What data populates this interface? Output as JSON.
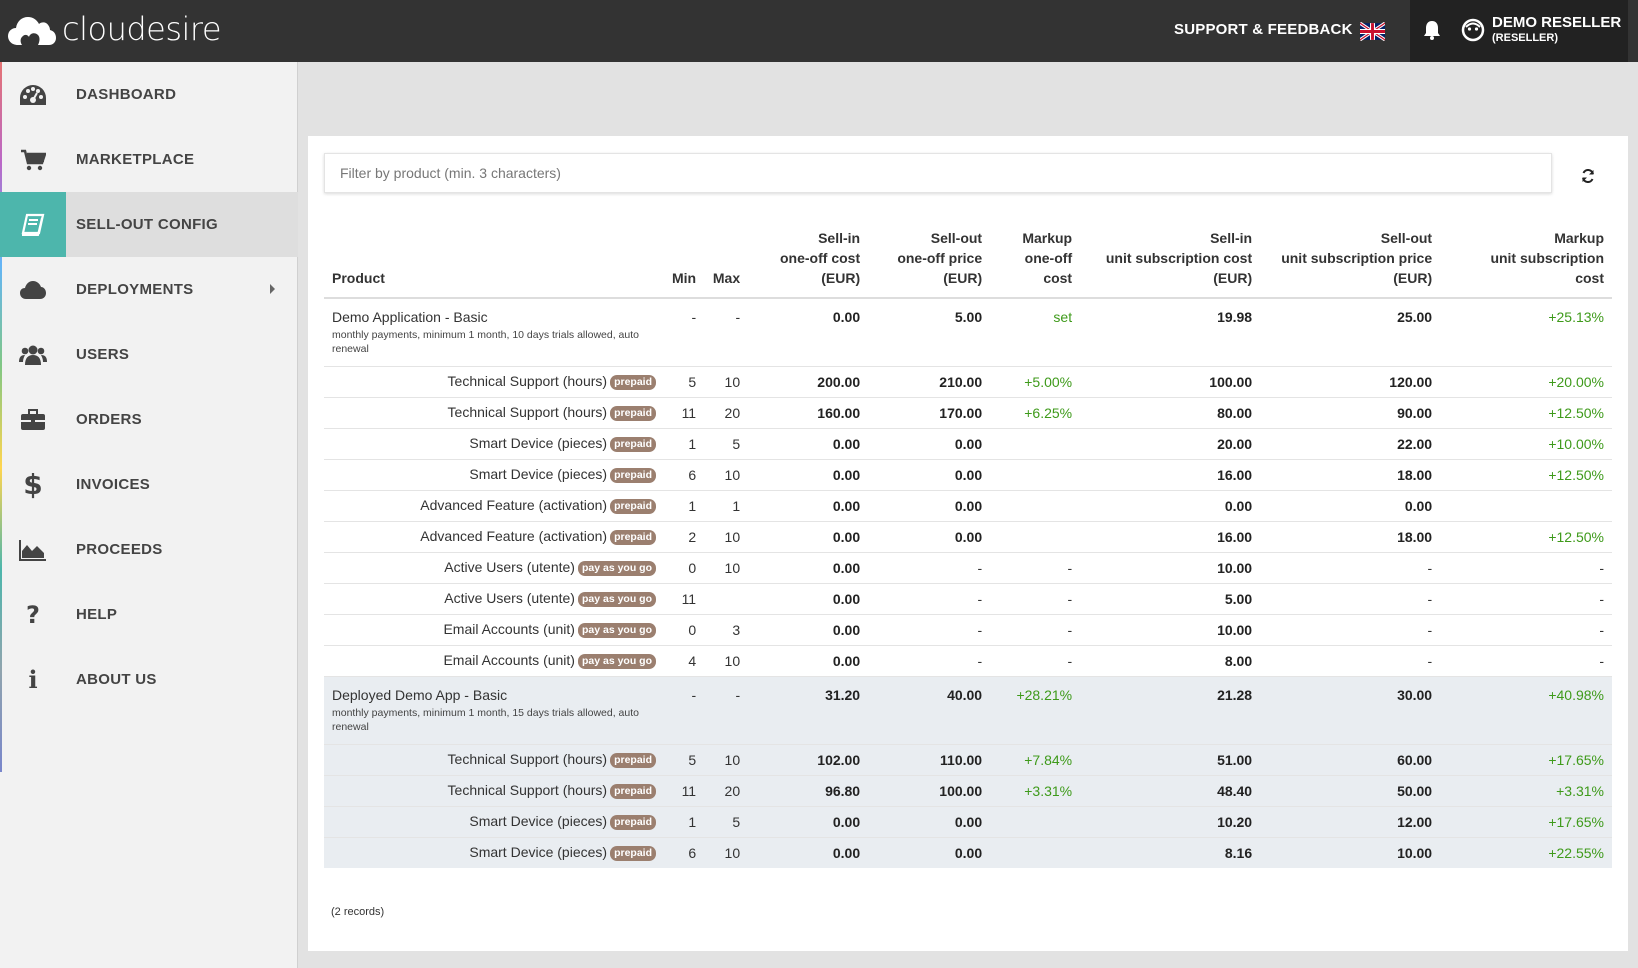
{
  "header": {
    "brand": "cloudesire",
    "support": "SUPPORT & FEEDBACK",
    "language_icon": "uk-flag-icon",
    "user_name": "DEMO RESELLER",
    "user_role": "(RESELLER)"
  },
  "sidebar": {
    "items": [
      {
        "label": "DASHBOARD",
        "icon": "dashboard-icon"
      },
      {
        "label": "MARKETPLACE",
        "icon": "cart-icon"
      },
      {
        "label": "SELL-OUT CONFIG",
        "icon": "book-icon"
      },
      {
        "label": "DEPLOYMENTS",
        "icon": "cloud-icon"
      },
      {
        "label": "USERS",
        "icon": "users-icon"
      },
      {
        "label": "ORDERS",
        "icon": "briefcase-icon"
      },
      {
        "label": "INVOICES",
        "icon": "dollar-icon"
      },
      {
        "label": "PROCEEDS",
        "icon": "area-chart-icon"
      },
      {
        "label": "HELP",
        "icon": "question-icon"
      },
      {
        "label": "ABOUT US",
        "icon": "info-icon"
      }
    ],
    "active": "SELL-OUT CONFIG",
    "accent_color": "#4db6ac"
  },
  "filter": {
    "placeholder": "Filter by product (min. 3 characters)",
    "value": ""
  },
  "table": {
    "headers": {
      "product": "Product",
      "min": "Min",
      "max": "Max",
      "sellin_oneoff": [
        "Sell-in",
        "one-off cost",
        "(EUR)"
      ],
      "sellout_oneoff": [
        "Sell-out",
        "one-off price",
        "(EUR)"
      ],
      "markup_oneoff": [
        "Markup",
        "one-off",
        "cost"
      ],
      "sellin_unit": [
        "Sell-in",
        "unit subscription cost",
        "(EUR)"
      ],
      "sellout_unit": [
        "Sell-out",
        "unit subscription price",
        "(EUR)"
      ],
      "markup_unit": [
        "Markup",
        "unit subscription",
        "cost"
      ]
    },
    "groups": [
      {
        "name": "Demo Application - Basic",
        "description": "monthly payments, minimum 1 month, 10 days trials allowed, auto renewal",
        "min": "-",
        "max": "-",
        "sellin_oneoff": "0.00",
        "sellout_oneoff": "5.00",
        "markup_oneoff": "set",
        "sellin_unit": "19.98",
        "sellout_unit": "25.00",
        "markup_unit": "+25.13%",
        "rows": [
          {
            "name": "Technical Support (hours)",
            "badge": "prepaid",
            "min": "5",
            "max": "10",
            "sellin_oneoff": "200.00",
            "sellout_oneoff": "210.00",
            "markup_oneoff": "+5.00%",
            "sellin_unit": "100.00",
            "sellout_unit": "120.00",
            "markup_unit": "+20.00%"
          },
          {
            "name": "Technical Support (hours)",
            "badge": "prepaid",
            "min": "11",
            "max": "20",
            "sellin_oneoff": "160.00",
            "sellout_oneoff": "170.00",
            "markup_oneoff": "+6.25%",
            "sellin_unit": "80.00",
            "sellout_unit": "90.00",
            "markup_unit": "+12.50%"
          },
          {
            "name": "Smart Device (pieces)",
            "badge": "prepaid",
            "min": "1",
            "max": "5",
            "sellin_oneoff": "0.00",
            "sellout_oneoff": "0.00",
            "markup_oneoff": "",
            "sellin_unit": "20.00",
            "sellout_unit": "22.00",
            "markup_unit": "+10.00%"
          },
          {
            "name": "Smart Device (pieces)",
            "badge": "prepaid",
            "min": "6",
            "max": "10",
            "sellin_oneoff": "0.00",
            "sellout_oneoff": "0.00",
            "markup_oneoff": "",
            "sellin_unit": "16.00",
            "sellout_unit": "18.00",
            "markup_unit": "+12.50%"
          },
          {
            "name": "Advanced Feature (activation)",
            "badge": "prepaid",
            "min": "1",
            "max": "1",
            "sellin_oneoff": "0.00",
            "sellout_oneoff": "0.00",
            "markup_oneoff": "",
            "sellin_unit": "0.00",
            "sellout_unit": "0.00",
            "markup_unit": ""
          },
          {
            "name": "Advanced Feature (activation)",
            "badge": "prepaid",
            "min": "2",
            "max": "10",
            "sellin_oneoff": "0.00",
            "sellout_oneoff": "0.00",
            "markup_oneoff": "",
            "sellin_unit": "16.00",
            "sellout_unit": "18.00",
            "markup_unit": "+12.50%"
          },
          {
            "name": "Active Users (utente)",
            "badge": "pay as you go",
            "min": "0",
            "max": "10",
            "sellin_oneoff": "0.00",
            "sellout_oneoff": "-",
            "markup_oneoff": "-",
            "sellin_unit": "10.00",
            "sellout_unit": "-",
            "markup_unit": "-"
          },
          {
            "name": "Active Users (utente)",
            "badge": "pay as you go",
            "min": "11",
            "max": "",
            "sellin_oneoff": "0.00",
            "sellout_oneoff": "-",
            "markup_oneoff": "-",
            "sellin_unit": "5.00",
            "sellout_unit": "-",
            "markup_unit": "-"
          },
          {
            "name": "Email Accounts (unit)",
            "badge": "pay as you go",
            "min": "0",
            "max": "3",
            "sellin_oneoff": "0.00",
            "sellout_oneoff": "-",
            "markup_oneoff": "-",
            "sellin_unit": "10.00",
            "sellout_unit": "-",
            "markup_unit": "-"
          },
          {
            "name": "Email Accounts (unit)",
            "badge": "pay as you go",
            "min": "4",
            "max": "10",
            "sellin_oneoff": "0.00",
            "sellout_oneoff": "-",
            "markup_oneoff": "-",
            "sellin_unit": "8.00",
            "sellout_unit": "-",
            "markup_unit": "-"
          }
        ]
      },
      {
        "name": "Deployed Demo App - Basic",
        "description": "monthly payments, minimum 1 month, 15 days trials allowed, auto renewal",
        "min": "-",
        "max": "-",
        "sellin_oneoff": "31.20",
        "sellout_oneoff": "40.00",
        "markup_oneoff": "+28.21%",
        "sellin_unit": "21.28",
        "sellout_unit": "30.00",
        "markup_unit": "+40.98%",
        "rows": [
          {
            "name": "Technical Support (hours)",
            "badge": "prepaid",
            "min": "5",
            "max": "10",
            "sellin_oneoff": "102.00",
            "sellout_oneoff": "110.00",
            "markup_oneoff": "+7.84%",
            "sellin_unit": "51.00",
            "sellout_unit": "60.00",
            "markup_unit": "+17.65%"
          },
          {
            "name": "Technical Support (hours)",
            "badge": "prepaid",
            "min": "11",
            "max": "20",
            "sellin_oneoff": "96.80",
            "sellout_oneoff": "100.00",
            "markup_oneoff": "+3.31%",
            "sellin_unit": "48.40",
            "sellout_unit": "50.00",
            "markup_unit": "+3.31%"
          },
          {
            "name": "Smart Device (pieces)",
            "badge": "prepaid",
            "min": "1",
            "max": "5",
            "sellin_oneoff": "0.00",
            "sellout_oneoff": "0.00",
            "markup_oneoff": "",
            "sellin_unit": "10.20",
            "sellout_unit": "12.00",
            "markup_unit": "+17.65%"
          },
          {
            "name": "Smart Device (pieces)",
            "badge": "prepaid",
            "min": "6",
            "max": "10",
            "sellin_oneoff": "0.00",
            "sellout_oneoff": "0.00",
            "markup_oneoff": "",
            "sellin_unit": "8.16",
            "sellout_unit": "10.00",
            "markup_unit": "+22.55%"
          }
        ]
      }
    ]
  },
  "footer": {
    "records": "(2 records)"
  },
  "colors": {
    "markup_green": "#3e9a1a",
    "badge_brown": "#9b7f6f",
    "group_highlight": "#e9edf1",
    "topbar": "#333333"
  }
}
